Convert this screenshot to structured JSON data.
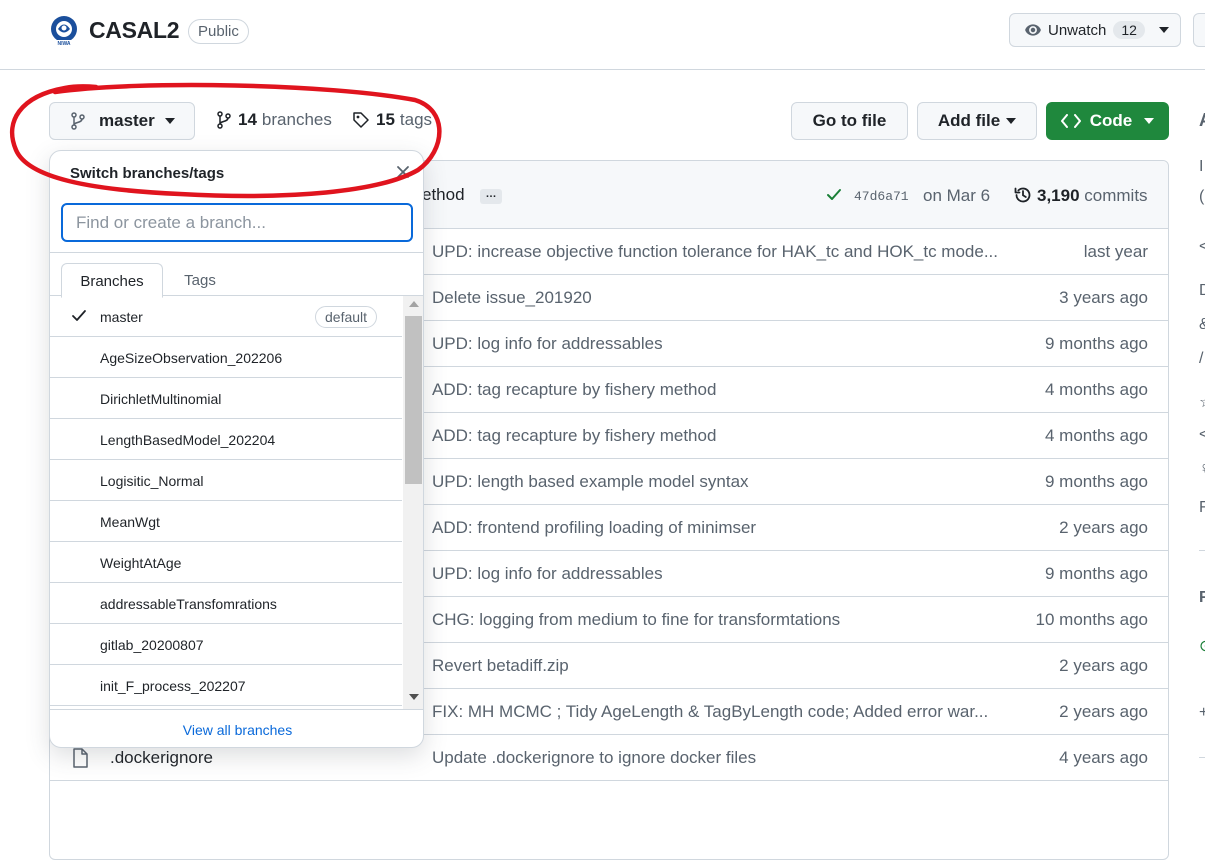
{
  "repo": {
    "name": "CASAL2",
    "visibility": "Public",
    "logo_icon": "niwa-logo-icon"
  },
  "watch": {
    "label": "Unwatch",
    "count": "12"
  },
  "toolbar": {
    "branch_label": "master",
    "branches_count": "14",
    "branches_label": "branches",
    "tags_count": "15",
    "tags_label": "tags",
    "goto_file_label": "Go to file",
    "add_file_label": "Add file",
    "code_label": "Code"
  },
  "latest_commit": {
    "message": "ethod",
    "ellipsis": "…",
    "sha": "47d6a71",
    "date": "on Mar 6",
    "count": "3,190",
    "count_label": "commits"
  },
  "files": [
    {
      "name": "",
      "message": "UPD: increase objective function tolerance for HAK_tc and HOK_tc mode...",
      "age": "last year"
    },
    {
      "name": "",
      "message": "Delete issue_201920",
      "age": "3 years ago"
    },
    {
      "name": "",
      "message": "UPD: log info for addressables",
      "age": "9 months ago"
    },
    {
      "name": "",
      "message": "ADD: tag recapture by fishery method",
      "age": "4 months ago"
    },
    {
      "name": "",
      "message": "ADD: tag recapture by fishery method",
      "age": "4 months ago"
    },
    {
      "name": "",
      "message": "UPD: length based example model syntax",
      "age": "9 months ago"
    },
    {
      "name": "",
      "message": "ADD: frontend profiling loading of minimser",
      "age": "2 years ago"
    },
    {
      "name": "",
      "message": "UPD: log info for addressables",
      "age": "9 months ago"
    },
    {
      "name": "",
      "message": "CHG: logging from medium to fine for transformtations",
      "age": "10 months ago"
    },
    {
      "name": "",
      "message": "Revert betadiff.zip",
      "age": "2 years ago"
    },
    {
      "name": "",
      "message": "FIX: MH MCMC ; Tidy AgeLength & TagByLength code; Added error war...",
      "age": "2 years ago"
    },
    {
      "name": ".dockerignore",
      "message": "Update .dockerignore to ignore docker files",
      "age": "4 years ago"
    }
  ],
  "dropdown": {
    "title": "Switch branches/tags",
    "search_placeholder": "Find or create a branch...",
    "tab_branches": "Branches",
    "tab_tags": "Tags",
    "default_badge": "default",
    "branches": [
      "master",
      "AgeSizeObservation_202206",
      "DirichletMultinomial",
      "LengthBasedModel_202204",
      "Logisitic_Normal",
      "MeanWgt",
      "WeightAtAge",
      "addressableTransfomrations",
      "gitlab_20200807",
      "init_F_process_202207"
    ],
    "view_all_label": "View all branches"
  },
  "sidebar_glyphs": [
    "A",
    "I",
    "(",
    "<",
    "D",
    "&",
    "/",
    "☆",
    "<",
    "♀",
    "F",
    "F",
    "⊙",
    "+"
  ],
  "colors": {
    "accent": "#0969da",
    "code_button": "#1f883d",
    "annotation": "#e0141e",
    "success": "#1a7f37"
  }
}
